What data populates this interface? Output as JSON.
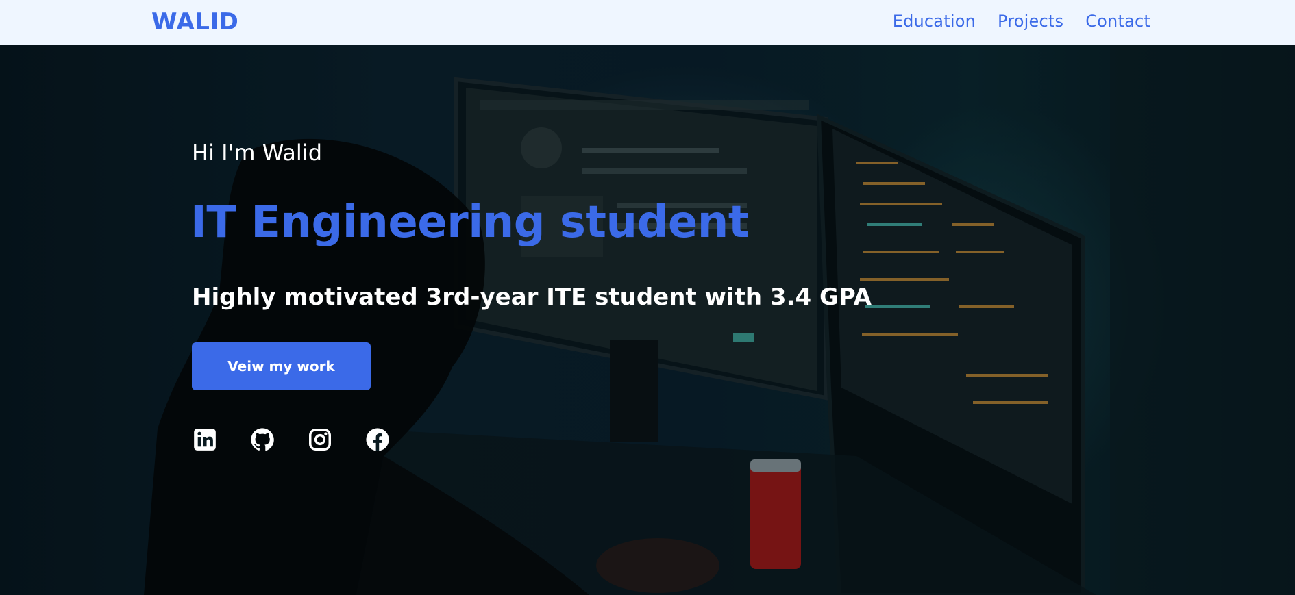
{
  "nav": {
    "logo": "WALID",
    "links": [
      {
        "label": "Education"
      },
      {
        "label": "Projects"
      },
      {
        "label": "Contact"
      }
    ]
  },
  "hero": {
    "greeting": "Hi I'm Walid",
    "title": "IT Engineering student",
    "subtitle": "Highly motivated 3rd-year ITE student with 3.4 GPA",
    "cta_label": "Veiw my work",
    "socials": [
      {
        "icon": "linkedin-icon"
      },
      {
        "icon": "github-icon"
      },
      {
        "icon": "instagram-icon"
      },
      {
        "icon": "facebook-icon"
      }
    ]
  },
  "colors": {
    "accent": "#3b6ae8",
    "nav_background": "#eff6ff",
    "text_on_dark": "#ffffff"
  }
}
